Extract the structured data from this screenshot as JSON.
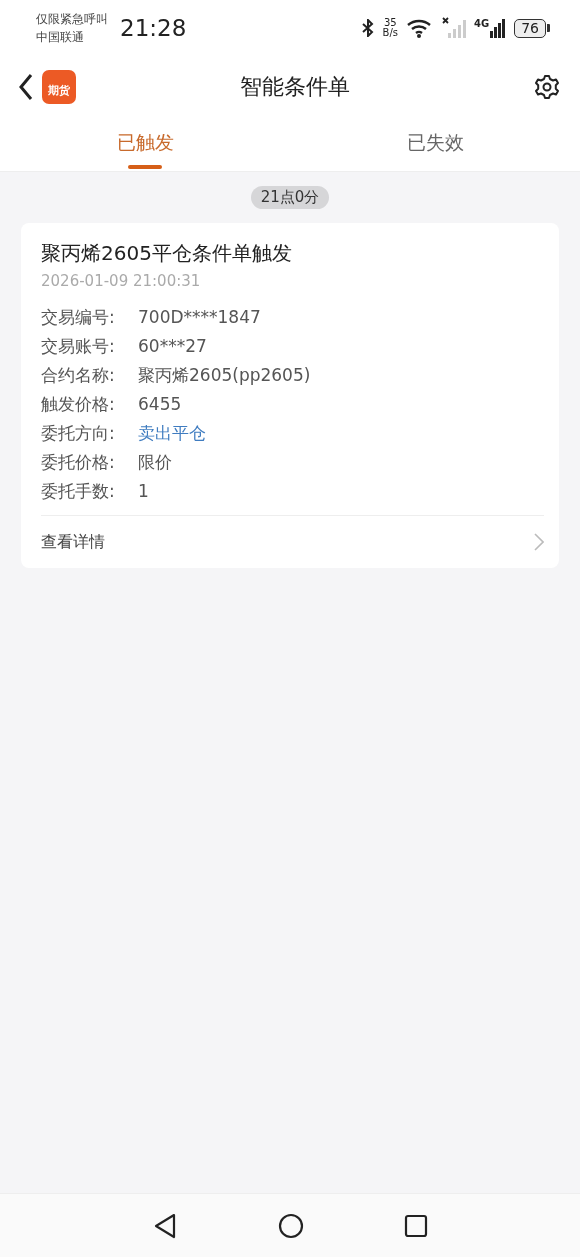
{
  "status_bar": {
    "notice": "仅限紧急呼叫",
    "carrier": "中国联通",
    "time": "21:28",
    "speed_value": "35",
    "speed_unit": "B/s",
    "network": "4G",
    "battery": "76"
  },
  "header": {
    "logo_text": "期货",
    "title": "智能条件单"
  },
  "tabs": [
    {
      "label": "已触发",
      "selected": true
    },
    {
      "label": "已失效",
      "selected": false
    }
  ],
  "time_group": "21点0分",
  "orders": [
    {
      "title": "聚丙烯2605平仓条件单触发",
      "datetime": "2026-01-09 21:00:31",
      "fields": [
        {
          "label": "交易编号:",
          "value": "700D****1847",
          "highlight": false
        },
        {
          "label": "交易账号:",
          "value": "60***27",
          "highlight": false
        },
        {
          "label": "合约名称:",
          "value": "聚丙烯2605(pp2605)",
          "highlight": false
        },
        {
          "label": "触发价格:",
          "value": "6455",
          "highlight": false
        },
        {
          "label": "委托方向:",
          "value": "卖出平仓",
          "highlight": true
        },
        {
          "label": "委托价格:",
          "value": "限价",
          "highlight": false
        },
        {
          "label": "委托手数:",
          "value": "1",
          "highlight": false
        }
      ],
      "link": "查看详情"
    }
  ]
}
